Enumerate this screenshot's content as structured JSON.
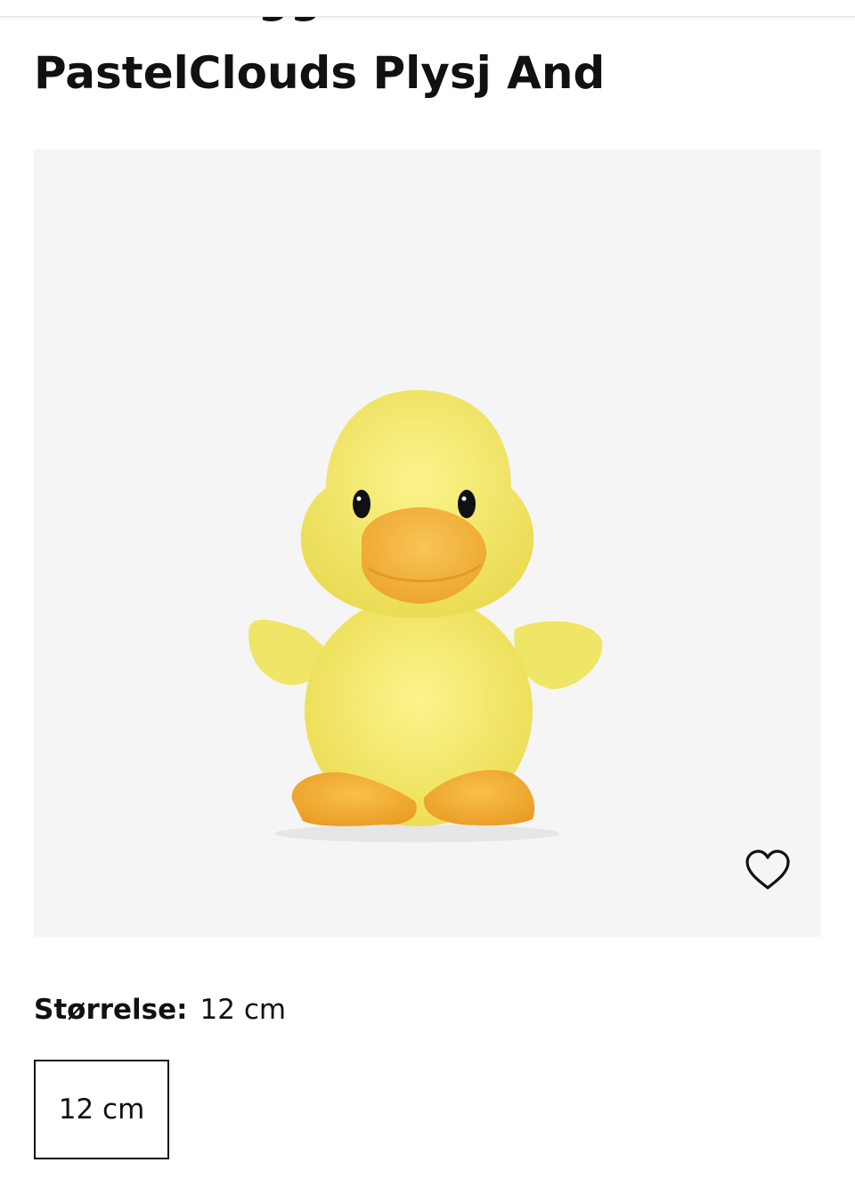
{
  "product": {
    "brand": "Little&Bigger",
    "title": "PastelClouds Plysj And",
    "image_alt": "Gul plysj and",
    "favorite_icon": "heart-outline-icon"
  },
  "size": {
    "label": "Størrelse:",
    "selected": "12 cm",
    "options": [
      "12 cm"
    ]
  },
  "colors": {
    "image_background": "#f5f5f5",
    "duck_body": "#f3ea6b",
    "duck_beak": "#f6b73c",
    "text": "#111111"
  }
}
